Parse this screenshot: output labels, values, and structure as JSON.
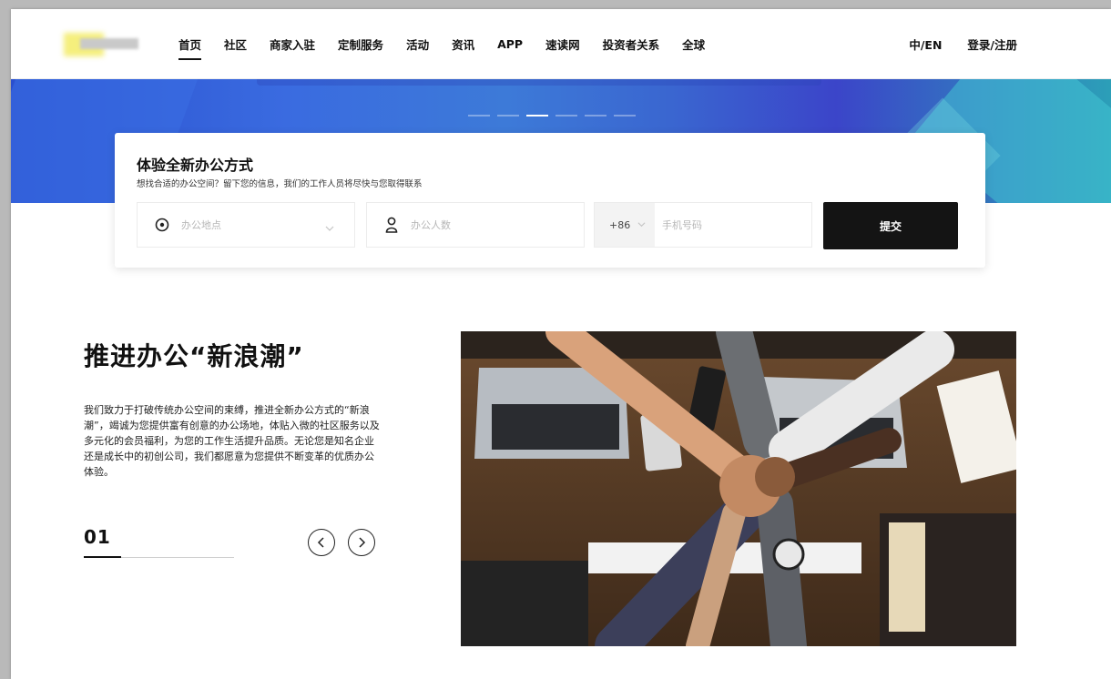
{
  "header": {
    "nav": [
      "首页",
      "社区",
      "商家入驻",
      "定制服务",
      "活动",
      "资讯",
      "APP",
      "速读网",
      "投资者关系",
      "全球"
    ],
    "language": "中/EN",
    "login": "登录/注册"
  },
  "form": {
    "title": "体验全新办公方式",
    "subtitle": "想找合适的办公空间？留下您的信息，我们的工作人员将尽快与您取得联系",
    "location_placeholder": "办公地点",
    "people_placeholder": "办公人数",
    "country_code": "+86",
    "phone_placeholder": "手机号码",
    "submit": "提交"
  },
  "intro": {
    "title": "推进办公“新浪潮”",
    "description": "我们致力于打破传统办公空间的束缚，推进全新办公方式的“新浪潮”，竭诚为您提供富有创意的办公场地，体贴入微的社区服务以及多元化的会员福利，为您的工作生活提升品质。无论您是知名企业还是成长中的初创公司，我们都愿意为您提供不断变革的优质办公体验。",
    "counter": "01",
    "progress": 0.25
  },
  "banner": {
    "slides": 6,
    "active_slide": 3
  },
  "colors": {
    "accent": "#141414",
    "banner_blue": "#3a6be0",
    "banner_teal": "#2c9fb8"
  },
  "icons": [
    "location-pin-icon",
    "person-icon",
    "chevron-down-icon",
    "arrow-left-icon",
    "arrow-right-icon"
  ]
}
